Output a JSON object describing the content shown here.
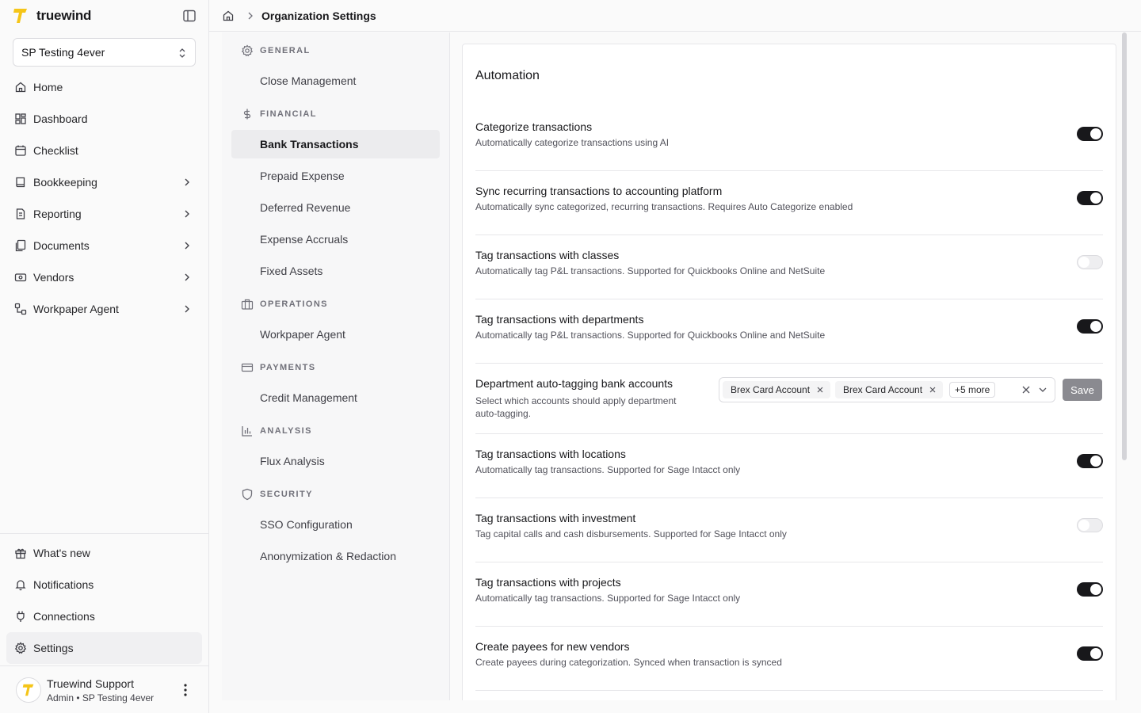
{
  "app": {
    "name": "truewind",
    "brand_color": "#F5C518"
  },
  "org_selector": {
    "value": "SP Testing 4ever"
  },
  "sidebar": {
    "items": [
      {
        "label": "Home",
        "icon": "home-icon",
        "has_children": false
      },
      {
        "label": "Dashboard",
        "icon": "dashboard-icon",
        "has_children": false
      },
      {
        "label": "Checklist",
        "icon": "calendar-icon",
        "has_children": false
      },
      {
        "label": "Bookkeeping",
        "icon": "book-icon",
        "has_children": true
      },
      {
        "label": "Reporting",
        "icon": "report-icon",
        "has_children": true
      },
      {
        "label": "Documents",
        "icon": "documents-icon",
        "has_children": true
      },
      {
        "label": "Vendors",
        "icon": "vendors-icon",
        "has_children": true
      },
      {
        "label": "Workpaper Agent",
        "icon": "workflow-icon",
        "has_children": true
      }
    ],
    "bottom_items": [
      {
        "label": "What's new",
        "icon": "gift-icon"
      },
      {
        "label": "Notifications",
        "icon": "bell-icon"
      },
      {
        "label": "Connections",
        "icon": "plug-icon"
      },
      {
        "label": "Settings",
        "icon": "gear-icon"
      }
    ],
    "user": {
      "name": "Truewind Support",
      "role": "Admin • SP Testing 4ever"
    }
  },
  "header": {
    "breadcrumb": "Organization Settings"
  },
  "settings_nav": {
    "sections": [
      {
        "title": "GENERAL",
        "icon": "gear-icon",
        "items": [
          "Close Management"
        ]
      },
      {
        "title": "FINANCIAL",
        "icon": "dollar-icon",
        "items": [
          "Bank Transactions",
          "Prepaid Expense",
          "Deferred Revenue",
          "Expense Accruals",
          "Fixed Assets"
        ]
      },
      {
        "title": "OPERATIONS",
        "icon": "briefcase-icon",
        "items": [
          "Workpaper Agent"
        ]
      },
      {
        "title": "PAYMENTS",
        "icon": "credit-card-icon",
        "items": [
          "Credit Management"
        ]
      },
      {
        "title": "ANALYSIS",
        "icon": "bar-chart-icon",
        "items": [
          "Flux Analysis"
        ]
      },
      {
        "title": "SECURITY",
        "icon": "shield-icon",
        "items": [
          "SSO Configuration",
          "Anonymization & Redaction"
        ]
      }
    ],
    "active": "Bank Transactions"
  },
  "automation": {
    "title": "Automation",
    "settings": [
      {
        "title": "Categorize transactions",
        "description": "Automatically categorize transactions using AI",
        "enabled": true
      },
      {
        "title": "Sync recurring transactions to accounting platform",
        "description": "Automatically sync categorized, recurring transactions. Requires Auto Categorize enabled",
        "enabled": true
      },
      {
        "title": "Tag transactions with classes",
        "description": "Automatically tag P&L transactions. Supported for Quickbooks Online and NetSuite",
        "enabled": false
      },
      {
        "title": "Tag transactions with departments",
        "description": "Automatically tag P&L transactions. Supported for Quickbooks Online and NetSuite",
        "enabled": true
      },
      {
        "title": "Tag transactions with locations",
        "description": "Automatically tag transactions. Supported for Sage Intacct only",
        "enabled": true
      },
      {
        "title": "Tag transactions with investment",
        "description": "Tag capital calls and cash disbursements. Supported for Sage Intacct only",
        "enabled": false
      },
      {
        "title": "Tag transactions with projects",
        "description": "Automatically tag transactions. Supported for Sage Intacct only",
        "enabled": true
      },
      {
        "title": "Create payees for new vendors",
        "description": "Create payees during categorization. Synced when transaction is synced",
        "enabled": true
      }
    ],
    "dept_accounts": {
      "title": "Department auto-tagging bank accounts",
      "description_line1": "Select which accounts should apply department",
      "description_line2": "auto-tagging.",
      "chips": [
        "Brex Card Account",
        "Brex Card Account"
      ],
      "more": "+5 more",
      "save_label": "Save"
    }
  }
}
